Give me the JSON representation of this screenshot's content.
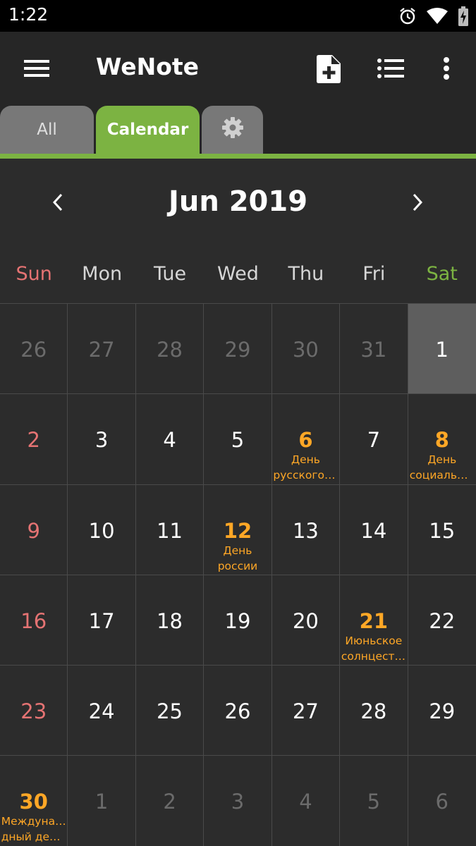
{
  "status_bar": {
    "time": "1:22"
  },
  "app_bar": {
    "title": "WeNote"
  },
  "tabs": [
    {
      "label": "All"
    },
    {
      "label": "Calendar"
    }
  ],
  "calendar": {
    "month_title": "Jun 2019",
    "weekdays": [
      "Sun",
      "Mon",
      "Tue",
      "Wed",
      "Thu",
      "Fri",
      "Sat"
    ],
    "days": [
      {
        "n": "26",
        "other": true
      },
      {
        "n": "27",
        "other": true
      },
      {
        "n": "28",
        "other": true
      },
      {
        "n": "29",
        "other": true
      },
      {
        "n": "30",
        "other": true
      },
      {
        "n": "31",
        "other": true
      },
      {
        "n": "1",
        "today": true
      },
      {
        "n": "2",
        "sun": true
      },
      {
        "n": "3"
      },
      {
        "n": "4"
      },
      {
        "n": "5"
      },
      {
        "n": "6",
        "holiday": true,
        "events": [
          "День",
          "русского …"
        ]
      },
      {
        "n": "7"
      },
      {
        "n": "8",
        "holiday": true,
        "events": [
          "День",
          "социальн…"
        ]
      },
      {
        "n": "9",
        "sun": true
      },
      {
        "n": "10"
      },
      {
        "n": "11"
      },
      {
        "n": "12",
        "holiday": true,
        "events": [
          "День",
          "россии"
        ]
      },
      {
        "n": "13"
      },
      {
        "n": "14"
      },
      {
        "n": "15"
      },
      {
        "n": "16",
        "sun": true
      },
      {
        "n": "17"
      },
      {
        "n": "18"
      },
      {
        "n": "19"
      },
      {
        "n": "20"
      },
      {
        "n": "21",
        "holiday": true,
        "events": [
          "Июньское",
          "солнцесто…"
        ]
      },
      {
        "n": "22"
      },
      {
        "n": "23",
        "sun": true
      },
      {
        "n": "24"
      },
      {
        "n": "25"
      },
      {
        "n": "26"
      },
      {
        "n": "27"
      },
      {
        "n": "28"
      },
      {
        "n": "29"
      },
      {
        "n": "30",
        "holiday": true,
        "events": [
          "Междунаро",
          "дный ден…"
        ]
      },
      {
        "n": "1",
        "other": true
      },
      {
        "n": "2",
        "other": true
      },
      {
        "n": "3",
        "other": true
      },
      {
        "n": "4",
        "other": true
      },
      {
        "n": "5",
        "other": true
      },
      {
        "n": "6",
        "other": true
      }
    ]
  },
  "colors": {
    "accent": "#7cb342",
    "holiday": "#ffa726",
    "sunday": "#e57373",
    "background": "#2c2c2c"
  },
  "icons": [
    "alarm-icon",
    "wifi-icon",
    "battery-charging-icon",
    "menu-icon",
    "new-note-icon",
    "list-view-icon",
    "more-vert-icon",
    "settings-gear-icon",
    "chevron-left-icon",
    "chevron-right-icon"
  ]
}
